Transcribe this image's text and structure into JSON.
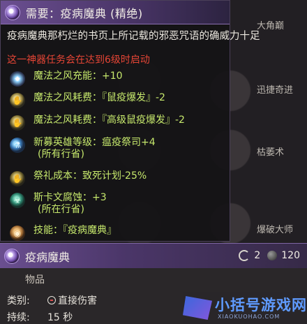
{
  "tooltip": {
    "title": "需要：疫病魔典 (精绝)",
    "description": "疫病魔典那朽烂的书页上所记载的邪恶咒语的确威力十足",
    "warning": "这一神器任务会在达到6级时启动",
    "perks": [
      {
        "icon": "sparkle-icon",
        "text": "魔法之风充能：+10"
      },
      {
        "icon": "rat-hand-icon",
        "text": "魔法之风耗费：『鼠疫爆发』-2"
      },
      {
        "icon": "rat-hand-icon",
        "text": "魔法之风耗费：『高级鼠疫爆发』-2"
      },
      {
        "icon": "plague-priest-icon",
        "text": "新募英雄等级：瘟疫祭司+4",
        "sub": "(所有行省)"
      },
      {
        "icon": "ritual-icon",
        "text": "祭礼成本：致死计划-25%"
      },
      {
        "icon": "skaven-corruption-icon",
        "text": "斯卡文腐蚀：+3",
        "sub": "(所在行省)"
      },
      {
        "icon": "skill-icon",
        "text": "技能：『疫病魔典』"
      }
    ]
  },
  "background": {
    "labels": [
      "大角巅",
      "迅捷奇进",
      "枯萎术",
      "爆破大师"
    ]
  },
  "card": {
    "title": "疫病魔典",
    "cooldown": "2",
    "cost": "120",
    "type": "物品",
    "rows": [
      {
        "key": "类别:",
        "value": "直接伤害"
      },
      {
        "key": "持续:",
        "value": "15 秒"
      }
    ]
  },
  "watermark": {
    "text": "小括号游戏网",
    "sub": "XIAOKUOHAO.COM"
  }
}
